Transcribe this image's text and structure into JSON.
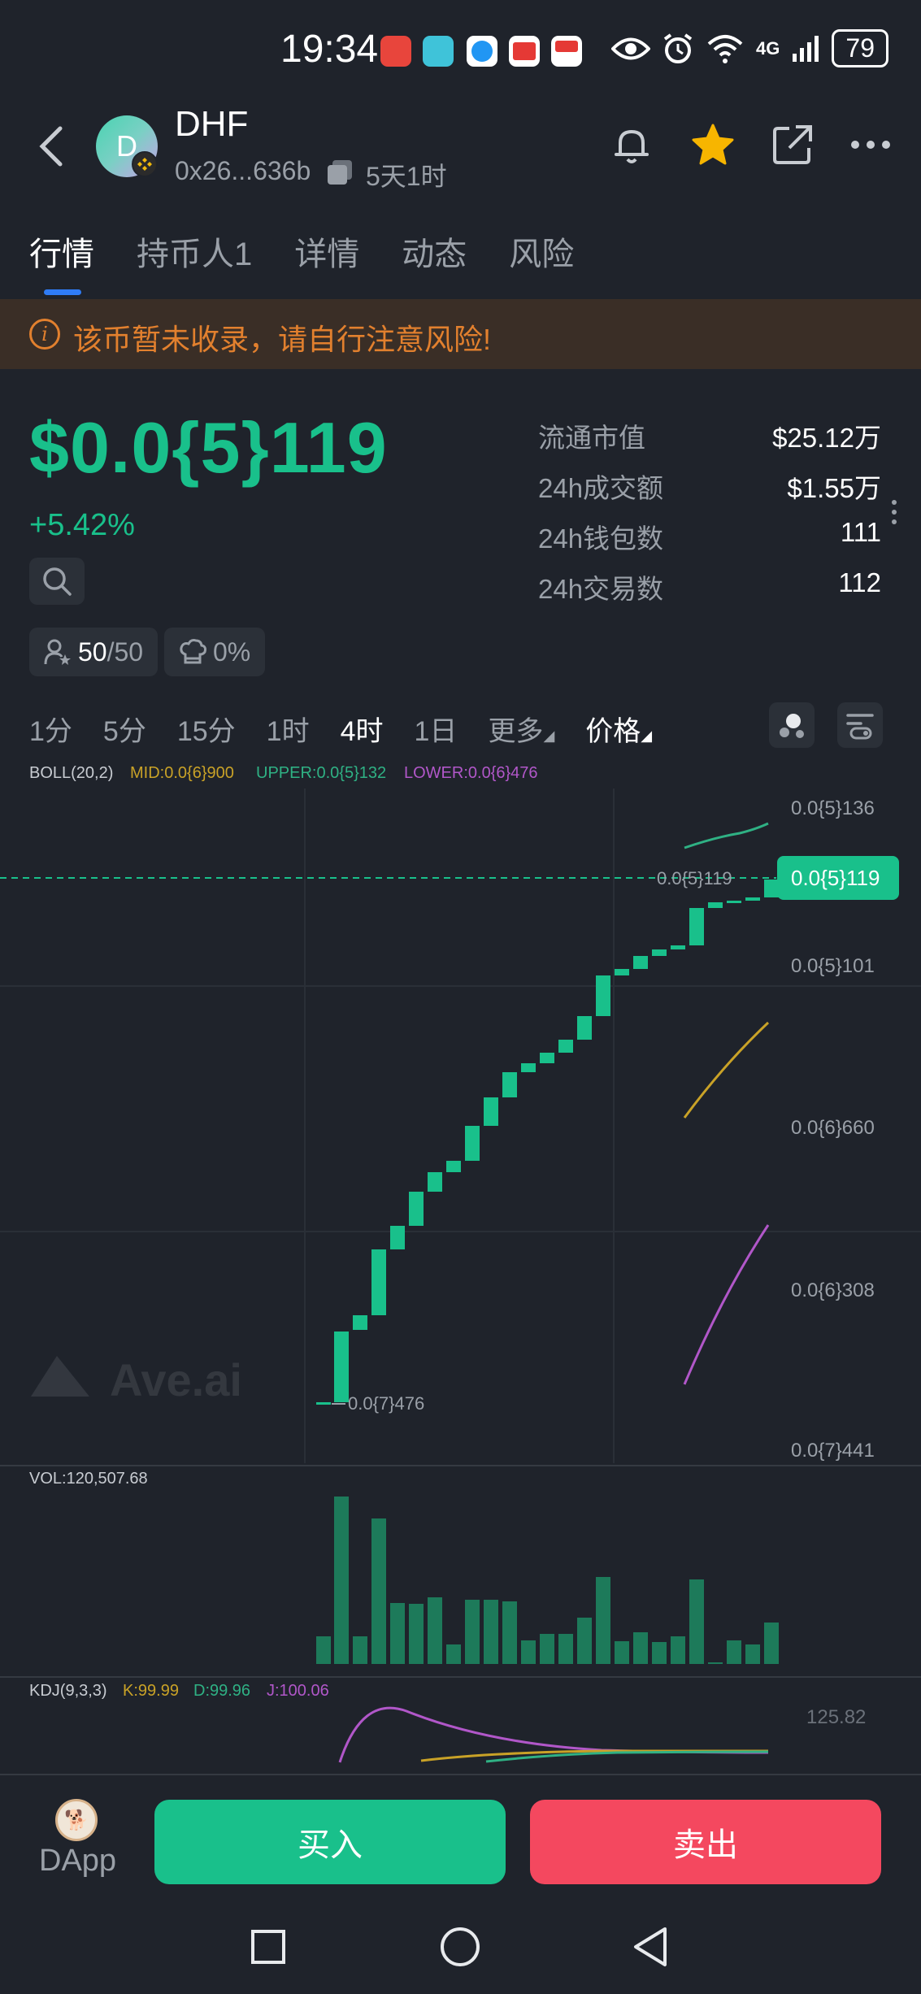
{
  "status_bar": {
    "time": "19:34",
    "network": "4G",
    "battery": "79",
    "icons": [
      "huawei-app-icon",
      "download-icon",
      "browser-icon",
      "reader-icon",
      "wallet-icon",
      "eye-icon",
      "alarm-icon",
      "wifi-icon",
      "signal-icon",
      "battery-icon"
    ]
  },
  "header": {
    "avatar_letter": "D",
    "token_name": "DHF",
    "address": "0x26...636b",
    "age": "5天1时"
  },
  "tabs": [
    "行情",
    "持币人1",
    "详情",
    "动态",
    "风险"
  ],
  "warning": "该币暂未收录，请自行注意风险!",
  "price": {
    "value": "$0.0{5}119",
    "change": "+5.42%",
    "holders_current": "50",
    "holders_total": "/50",
    "tax": "0%"
  },
  "stats": [
    {
      "label": "流通市值",
      "value": "$25.12万"
    },
    {
      "label": "24h成交额",
      "value": "$1.55万"
    },
    {
      "label": "24h钱包数",
      "value": "111"
    },
    {
      "label": "24h交易数",
      "value": "112"
    }
  ],
  "intervals": [
    "1分",
    "5分",
    "15分",
    "1时",
    "4时",
    "1日",
    "更多",
    "价格"
  ],
  "active_interval": "4时",
  "chart": {
    "boll_label": "BOLL(20,2)",
    "boll_mid": "MID:0.0{6}900",
    "boll_upper": "UPPER:0.0{5}132",
    "boll_lower": "LOWER:0.0{6}476",
    "y_ticks": [
      "0.0{5}136",
      "0.0{5}101",
      "0.0{6}660",
      "0.0{6}308",
      "0.0{7}441"
    ],
    "current_price_tag": "0.0{5}119",
    "current_price_marker": "0.0{5}119",
    "low_marker": "0.0{7}476",
    "watermark": "Ave.ai",
    "vol_label": "VOL:120,507.68",
    "kdj_label": "KDJ(9,3,3)",
    "kdj_k": "K:99.99",
    "kdj_d": "D:99.96",
    "kdj_j": "J:100.06",
    "kdj_axis": "125.82",
    "colors": {
      "up": "#19c08b",
      "mid": "#c9a227",
      "upper": "#2fb184",
      "lower": "#b157c9"
    }
  },
  "actions": {
    "dapp": "DApp",
    "buy": "买入",
    "sell": "卖出"
  }
}
